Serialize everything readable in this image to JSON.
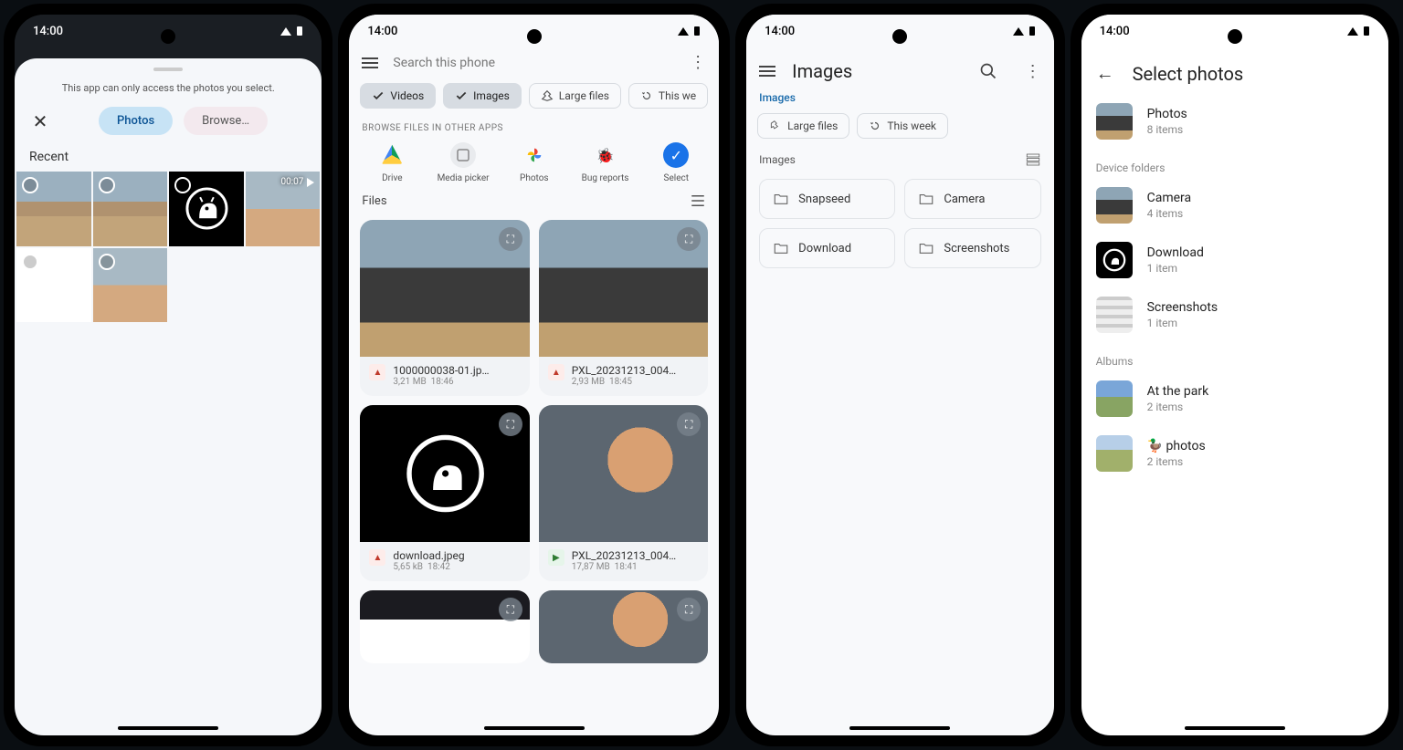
{
  "status_time": "14:00",
  "phone1": {
    "access_msg": "This app can only access the photos you select.",
    "tab_photos": "Photos",
    "tab_browse": "Browse…",
    "section_recent": "Recent",
    "video_duration": "00:07"
  },
  "phone2": {
    "search_placeholder": "Search this phone",
    "chips": {
      "videos": "Videos",
      "images": "Images",
      "large": "Large files",
      "week": "This we"
    },
    "browse_hdr": "BROWSE FILES IN OTHER APPS",
    "apps": {
      "drive": "Drive",
      "media": "Media picker",
      "photos": "Photos",
      "bug": "Bug reports",
      "select": "Select"
    },
    "files_label": "Files",
    "files": [
      {
        "name": "1000000038-01.jp…",
        "size": "3,21 MB",
        "time": "18:46",
        "type": "img"
      },
      {
        "name": "PXL_20231213_004…",
        "size": "2,93 MB",
        "time": "18:45",
        "type": "img"
      },
      {
        "name": "download.jpeg",
        "size": "5,65 kB",
        "time": "18:42",
        "type": "img"
      },
      {
        "name": "PXL_20231213_004…",
        "size": "17,87 MB",
        "time": "18:41",
        "type": "vid"
      }
    ]
  },
  "phone3": {
    "title": "Images",
    "crumb": "Images",
    "chips": {
      "large": "Large files",
      "week": "This week"
    },
    "section": "Images",
    "folders": {
      "snapseed": "Snapseed",
      "camera": "Camera",
      "download": "Download",
      "screenshots": "Screenshots"
    }
  },
  "phone4": {
    "title": "Select photos",
    "photos": {
      "label": "Photos",
      "count": "8 items"
    },
    "hdr_device": "Device folders",
    "camera": {
      "label": "Camera",
      "count": "4 items"
    },
    "download": {
      "label": "Download",
      "count": "1 item"
    },
    "screenshots": {
      "label": "Screenshots",
      "count": "1 item"
    },
    "hdr_albums": "Albums",
    "park": {
      "label": "At the park",
      "count": "2 items"
    },
    "duck": {
      "label": "🦆 photos",
      "count": "2 items"
    }
  }
}
